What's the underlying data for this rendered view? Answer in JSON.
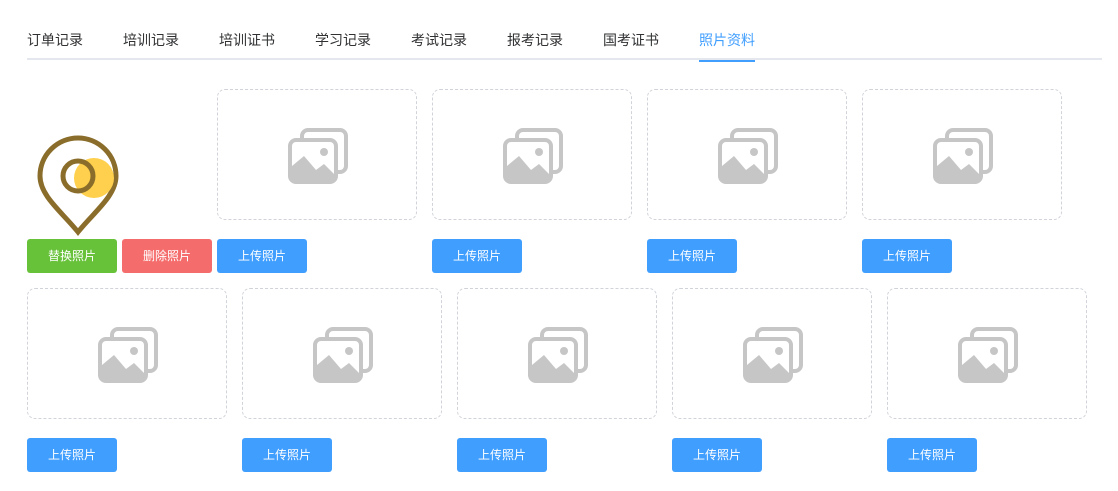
{
  "tabs": [
    {
      "label": "订单记录",
      "active": false
    },
    {
      "label": "培训记录",
      "active": false
    },
    {
      "label": "培训证书",
      "active": false
    },
    {
      "label": "学习记录",
      "active": false
    },
    {
      "label": "考试记录",
      "active": false
    },
    {
      "label": "报考记录",
      "active": false
    },
    {
      "label": "国考证书",
      "active": false
    },
    {
      "label": "照片资料",
      "active": true
    }
  ],
  "colors": {
    "accent": "#409eff",
    "replace": "#67c23a",
    "delete": "#f56c6c",
    "placeholder_icon": "#c6c6c6"
  },
  "photo": {
    "icon": "location-pin-icon",
    "replace_label": "替换照片",
    "delete_label": "删除照片"
  },
  "slots": {
    "upload_label": "上传照片",
    "placeholder_icon": "image-placeholder-icon"
  },
  "upload_buttons": [
    {
      "label": "上传照片"
    },
    {
      "label": "上传照片"
    },
    {
      "label": "上传照片"
    },
    {
      "label": "上传照片"
    },
    {
      "label": "上传照片"
    },
    {
      "label": "上传照片"
    },
    {
      "label": "上传照片"
    },
    {
      "label": "上传照片"
    },
    {
      "label": "上传照片"
    }
  ]
}
